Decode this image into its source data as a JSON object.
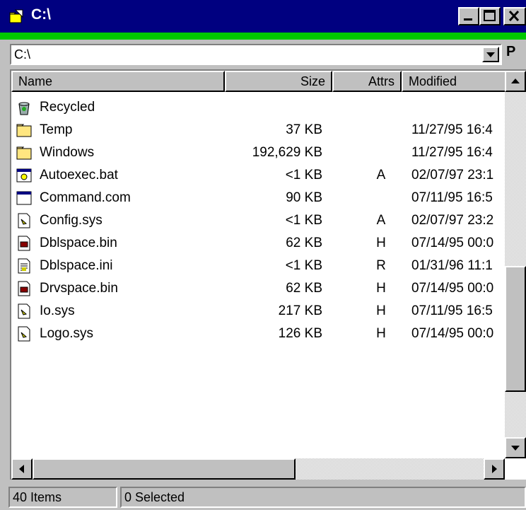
{
  "window": {
    "title": "C:\\",
    "icon": "folder-arrow-icon"
  },
  "address": {
    "value": "C:\\",
    "button_label": "P"
  },
  "columns": [
    {
      "label": "Name"
    },
    {
      "label": "Size"
    },
    {
      "label": "Attrs"
    },
    {
      "label": "Modified"
    }
  ],
  "files": [
    {
      "name": "Recycled",
      "size": "",
      "attrs": "",
      "modified": "",
      "icon": "recycle-bin-icon"
    },
    {
      "name": "Temp",
      "size": "37 KB",
      "attrs": "",
      "modified": "11/27/95 16:4",
      "icon": "folder-icon"
    },
    {
      "name": "Windows",
      "size": "192,629 KB",
      "attrs": "",
      "modified": "11/27/95 16:4",
      "icon": "folder-icon"
    },
    {
      "name": "Autoexec.bat",
      "size": "<1 KB",
      "attrs": "A",
      "modified": "02/07/97 23:1",
      "icon": "batch-file-icon"
    },
    {
      "name": "Command.com",
      "size": "90 KB",
      "attrs": "",
      "modified": "07/11/95 16:5",
      "icon": "program-icon"
    },
    {
      "name": "Config.sys",
      "size": "<1 KB",
      "attrs": "A",
      "modified": "02/07/97 23:2",
      "icon": "system-file-icon"
    },
    {
      "name": "Dblspace.bin",
      "size": "62 KB",
      "attrs": "H",
      "modified": "07/14/95 00:0",
      "icon": "binary-file-icon"
    },
    {
      "name": "Dblspace.ini",
      "size": "<1 KB",
      "attrs": "R",
      "modified": "01/31/96 11:1",
      "icon": "settings-file-icon"
    },
    {
      "name": "Drvspace.bin",
      "size": "62 KB",
      "attrs": "H",
      "modified": "07/14/95 00:0",
      "icon": "binary-file-icon"
    },
    {
      "name": "Io.sys",
      "size": "217 KB",
      "attrs": "H",
      "modified": "07/11/95 16:5",
      "icon": "system-file-icon"
    },
    {
      "name": "Logo.sys",
      "size": "126 KB",
      "attrs": "H",
      "modified": "07/14/95 00:0",
      "icon": "system-file-icon"
    }
  ],
  "status": {
    "items": "40 Items",
    "selected": "0 Selected"
  },
  "colors": {
    "titlebar": "#000080",
    "accent_bar": "#00c800",
    "face": "#c0c0c0"
  }
}
